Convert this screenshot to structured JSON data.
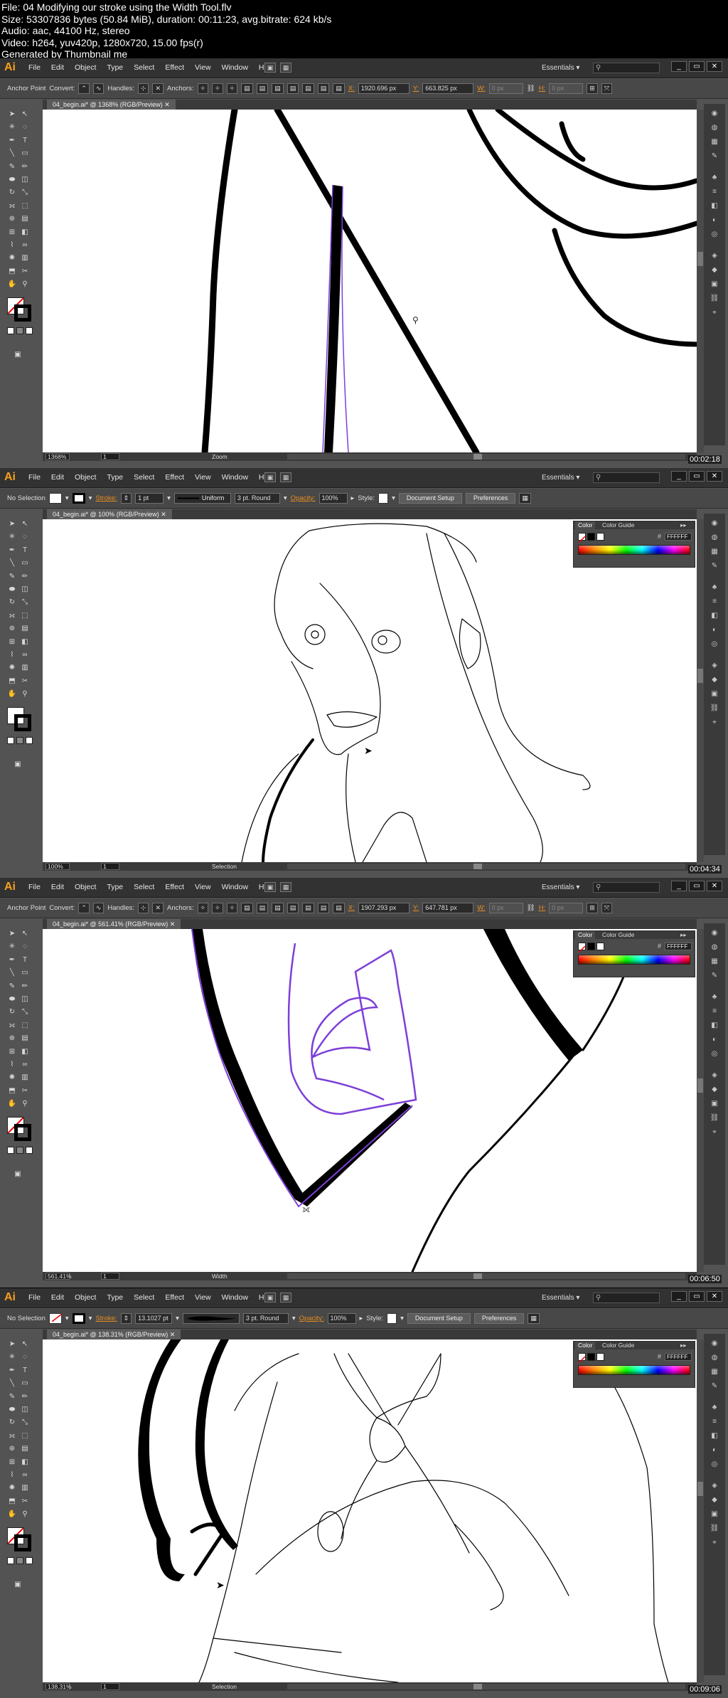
{
  "header": {
    "lines": [
      "File: 04 Modifying our stroke using the Width Tool.flv",
      "Size: 53307836 bytes (50.84 MiB), duration: 00:11:23, avg.bitrate: 624 kb/s",
      "Audio: aac, 44100 Hz, stereo",
      "Video: h264, yuv420p, 1280x720, 15.00 fps(r)",
      "Generated by Thumbnail me"
    ]
  },
  "app": {
    "logo": "Ai",
    "menus": [
      "File",
      "Edit",
      "Object",
      "Type",
      "Select",
      "Effect",
      "View",
      "Window",
      "Help"
    ],
    "workspace": "Essentials",
    "window_buttons": [
      "_",
      "▭",
      "✕"
    ]
  },
  "colors": {
    "accent_orange": "#e88c1d",
    "path_purple": "#7d3fd8",
    "ui_dark": "#323232",
    "ui_mid": "#535353"
  },
  "frames": [
    {
      "mode": "anchor",
      "control": {
        "label": "Anchor Point",
        "convert": "Convert:",
        "handles": "Handles:",
        "anchors": "Anchors:",
        "x_label": "X:",
        "x_value": "1920.696 px",
        "y_label": "Y:",
        "y_value": "663.825 px",
        "w_label": "W:",
        "w_value": "0 px",
        "h_label": "H:",
        "h_value": "0 px"
      },
      "doc_tab": "04_begin.ai* @ 1368% (RGB/Preview)",
      "zoom": "1368%",
      "page": "1",
      "status": "Zoom",
      "timestamp": "00:02:18",
      "color_panel": null
    },
    {
      "mode": "selection",
      "control": {
        "selection": "No Selection",
        "stroke_label": "Stroke:",
        "stroke_value": "1 pt",
        "profile": "Uniform",
        "brush": "3 pt. Round",
        "opacity_label": "Opacity:",
        "opacity_value": "100%",
        "style_label": "Style:",
        "doc_setup": "Document Setup",
        "preferences": "Preferences"
      },
      "doc_tab": "04_begin.ai* @ 100% (RGB/Preview)",
      "zoom": "100%",
      "page": "1",
      "status": "Selection",
      "timestamp": "00:04:34",
      "color_panel": {
        "tabs": [
          "Color",
          "Color Guide"
        ],
        "hex": "FFFFFF"
      }
    },
    {
      "mode": "anchor",
      "control": {
        "label": "Anchor Point",
        "convert": "Convert:",
        "handles": "Handles:",
        "anchors": "Anchors:",
        "x_label": "X:",
        "x_value": "1907.293 px",
        "y_label": "Y:",
        "y_value": "647.781 px",
        "w_label": "W:",
        "w_value": "0 px",
        "h_label": "H:",
        "h_value": "0 px"
      },
      "doc_tab": "04_begin.ai* @ 561.41% (RGB/Preview)",
      "zoom": "561.41%",
      "page": "1",
      "status": "Width",
      "timestamp": "00:06:50",
      "color_panel": {
        "tabs": [
          "Color",
          "Color Guide"
        ],
        "hex": "FFFFFF"
      }
    },
    {
      "mode": "selection",
      "control": {
        "selection": "No Selection",
        "stroke_label": "Stroke:",
        "stroke_value": "13.1027 pt",
        "profile": "",
        "brush": "3 pt. Round",
        "opacity_label": "Opacity:",
        "opacity_value": "100%",
        "style_label": "Style:",
        "doc_setup": "Document Setup",
        "preferences": "Preferences"
      },
      "doc_tab": "04_begin.ai* @ 138.31% (RGB/Preview)",
      "zoom": "138.31%",
      "page": "1",
      "status": "Selection",
      "timestamp": "00:09:06",
      "color_panel": {
        "tabs": [
          "Color",
          "Color Guide"
        ],
        "hex": "FFFFFF"
      }
    }
  ]
}
